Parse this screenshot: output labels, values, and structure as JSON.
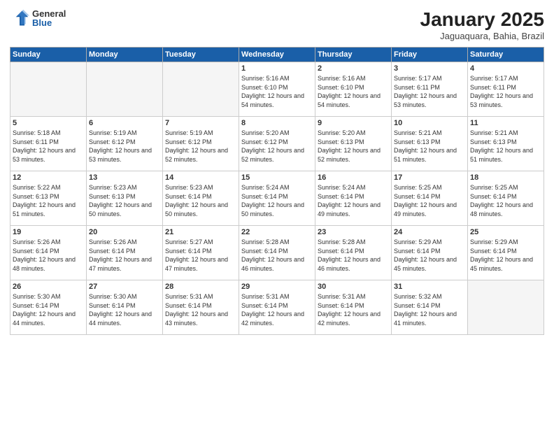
{
  "header": {
    "logo_general": "General",
    "logo_blue": "Blue",
    "month_title": "January 2025",
    "location": "Jaguaquara, Bahia, Brazil"
  },
  "weekdays": [
    "Sunday",
    "Monday",
    "Tuesday",
    "Wednesday",
    "Thursday",
    "Friday",
    "Saturday"
  ],
  "weeks": [
    [
      {
        "day": "",
        "empty": true
      },
      {
        "day": "",
        "empty": true
      },
      {
        "day": "",
        "empty": true
      },
      {
        "day": "1",
        "sunrise": "5:16 AM",
        "sunset": "6:10 PM",
        "daylight": "12 hours and 54 minutes."
      },
      {
        "day": "2",
        "sunrise": "5:16 AM",
        "sunset": "6:10 PM",
        "daylight": "12 hours and 54 minutes."
      },
      {
        "day": "3",
        "sunrise": "5:17 AM",
        "sunset": "6:11 PM",
        "daylight": "12 hours and 53 minutes."
      },
      {
        "day": "4",
        "sunrise": "5:17 AM",
        "sunset": "6:11 PM",
        "daylight": "12 hours and 53 minutes."
      }
    ],
    [
      {
        "day": "5",
        "sunrise": "5:18 AM",
        "sunset": "6:11 PM",
        "daylight": "12 hours and 53 minutes."
      },
      {
        "day": "6",
        "sunrise": "5:19 AM",
        "sunset": "6:12 PM",
        "daylight": "12 hours and 53 minutes."
      },
      {
        "day": "7",
        "sunrise": "5:19 AM",
        "sunset": "6:12 PM",
        "daylight": "12 hours and 52 minutes."
      },
      {
        "day": "8",
        "sunrise": "5:20 AM",
        "sunset": "6:12 PM",
        "daylight": "12 hours and 52 minutes."
      },
      {
        "day": "9",
        "sunrise": "5:20 AM",
        "sunset": "6:13 PM",
        "daylight": "12 hours and 52 minutes."
      },
      {
        "day": "10",
        "sunrise": "5:21 AM",
        "sunset": "6:13 PM",
        "daylight": "12 hours and 51 minutes."
      },
      {
        "day": "11",
        "sunrise": "5:21 AM",
        "sunset": "6:13 PM",
        "daylight": "12 hours and 51 minutes."
      }
    ],
    [
      {
        "day": "12",
        "sunrise": "5:22 AM",
        "sunset": "6:13 PM",
        "daylight": "12 hours and 51 minutes."
      },
      {
        "day": "13",
        "sunrise": "5:23 AM",
        "sunset": "6:13 PM",
        "daylight": "12 hours and 50 minutes."
      },
      {
        "day": "14",
        "sunrise": "5:23 AM",
        "sunset": "6:14 PM",
        "daylight": "12 hours and 50 minutes."
      },
      {
        "day": "15",
        "sunrise": "5:24 AM",
        "sunset": "6:14 PM",
        "daylight": "12 hours and 50 minutes."
      },
      {
        "day": "16",
        "sunrise": "5:24 AM",
        "sunset": "6:14 PM",
        "daylight": "12 hours and 49 minutes."
      },
      {
        "day": "17",
        "sunrise": "5:25 AM",
        "sunset": "6:14 PM",
        "daylight": "12 hours and 49 minutes."
      },
      {
        "day": "18",
        "sunrise": "5:25 AM",
        "sunset": "6:14 PM",
        "daylight": "12 hours and 48 minutes."
      }
    ],
    [
      {
        "day": "19",
        "sunrise": "5:26 AM",
        "sunset": "6:14 PM",
        "daylight": "12 hours and 48 minutes."
      },
      {
        "day": "20",
        "sunrise": "5:26 AM",
        "sunset": "6:14 PM",
        "daylight": "12 hours and 47 minutes."
      },
      {
        "day": "21",
        "sunrise": "5:27 AM",
        "sunset": "6:14 PM",
        "daylight": "12 hours and 47 minutes."
      },
      {
        "day": "22",
        "sunrise": "5:28 AM",
        "sunset": "6:14 PM",
        "daylight": "12 hours and 46 minutes."
      },
      {
        "day": "23",
        "sunrise": "5:28 AM",
        "sunset": "6:14 PM",
        "daylight": "12 hours and 46 minutes."
      },
      {
        "day": "24",
        "sunrise": "5:29 AM",
        "sunset": "6:14 PM",
        "daylight": "12 hours and 45 minutes."
      },
      {
        "day": "25",
        "sunrise": "5:29 AM",
        "sunset": "6:14 PM",
        "daylight": "12 hours and 45 minutes."
      }
    ],
    [
      {
        "day": "26",
        "sunrise": "5:30 AM",
        "sunset": "6:14 PM",
        "daylight": "12 hours and 44 minutes."
      },
      {
        "day": "27",
        "sunrise": "5:30 AM",
        "sunset": "6:14 PM",
        "daylight": "12 hours and 44 minutes."
      },
      {
        "day": "28",
        "sunrise": "5:31 AM",
        "sunset": "6:14 PM",
        "daylight": "12 hours and 43 minutes."
      },
      {
        "day": "29",
        "sunrise": "5:31 AM",
        "sunset": "6:14 PM",
        "daylight": "12 hours and 42 minutes."
      },
      {
        "day": "30",
        "sunrise": "5:31 AM",
        "sunset": "6:14 PM",
        "daylight": "12 hours and 42 minutes."
      },
      {
        "day": "31",
        "sunrise": "5:32 AM",
        "sunset": "6:14 PM",
        "daylight": "12 hours and 41 minutes."
      },
      {
        "day": "",
        "empty": true
      }
    ]
  ],
  "labels": {
    "sunrise_prefix": "Sunrise: ",
    "sunset_prefix": "Sunset: ",
    "daylight_prefix": "Daylight: "
  }
}
